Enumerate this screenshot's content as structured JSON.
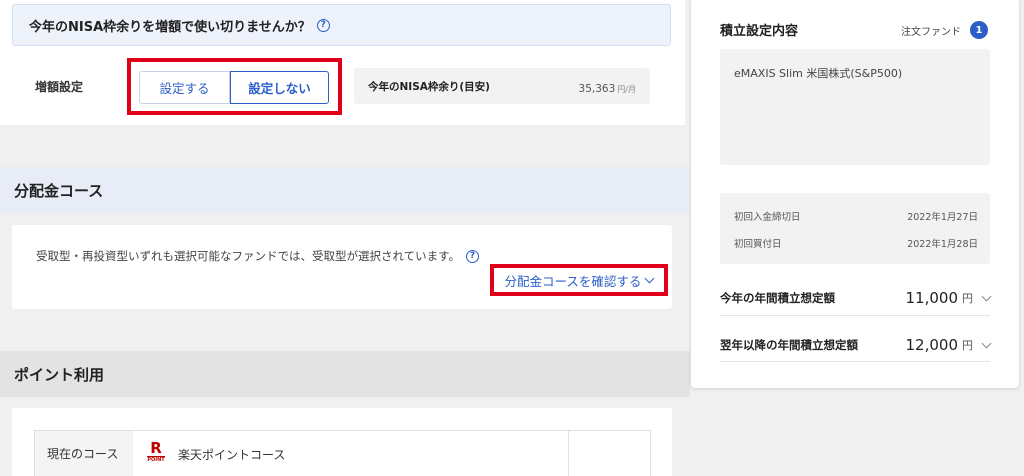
{
  "nisa": {
    "banner_text": "今年のNISA枠余りを増額で使い切りませんか？",
    "setting_label": "増額設定",
    "option_set": "設定する",
    "option_unset": "設定しない",
    "remaining_label": "今年のNISA枠余り(目安)",
    "remaining_value": "35,363",
    "remaining_unit": "円/月"
  },
  "dividend": {
    "section_title": "分配金コース",
    "description": "受取型・再投資型いずれも選択可能なファンドでは、受取型が選択されています。",
    "confirm_link": "分配金コースを確認する"
  },
  "points": {
    "section_title": "ポイント利用",
    "current_course_label": "現在のコース",
    "logo_letter": "R",
    "logo_text": "POINT",
    "current_course_value": "楽天ポイントコース"
  },
  "side_panel": {
    "title": "積立設定内容",
    "order_label": "注文ファンド",
    "order_count": "1",
    "fund_name": "eMAXIS Slim 米国株式(S&P500)",
    "first_deposit_deadline_label": "初回入金締切日",
    "first_deposit_deadline": "2022年1月27日",
    "first_purchase_label": "初回買付日",
    "first_purchase_date": "2022年1月28日",
    "annual_this_year_label": "今年の年間積立想定額",
    "annual_this_year_value": "11,000",
    "annual_next_years_label": "翌年以降の年間積立想定額",
    "annual_next_years_value": "12,000",
    "currency_unit": "円"
  },
  "colors": {
    "accent_blue": "#2b5fc7",
    "highlight_red": "#e1001a",
    "rakuten_red": "#bf0000"
  }
}
